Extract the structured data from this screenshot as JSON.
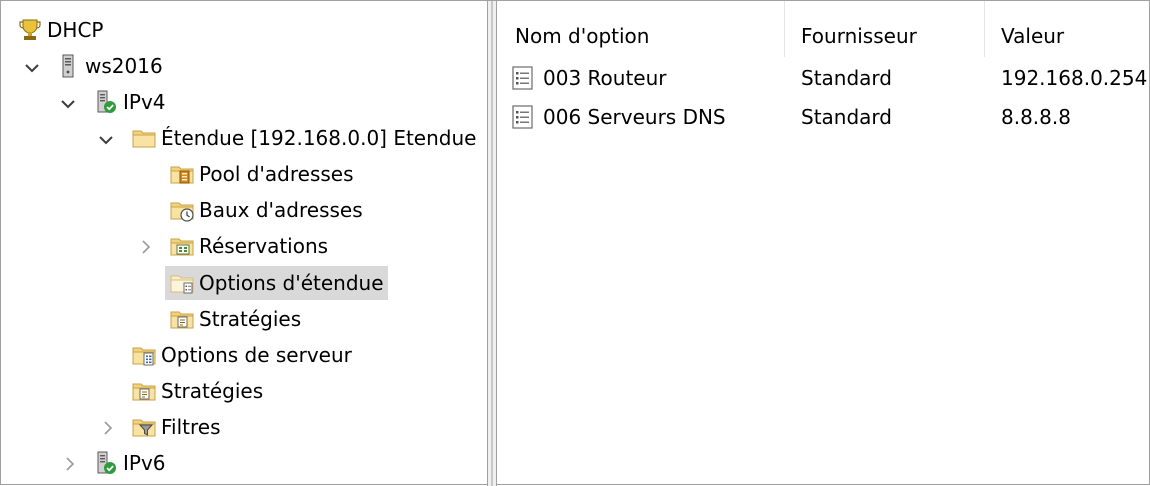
{
  "tree": {
    "nodes": [
      {
        "label": "DHCP",
        "icon": "dhcp-trophy-icon"
      },
      {
        "label": "ws2016",
        "icon": "server-icon"
      },
      {
        "label": "IPv4",
        "icon": "ipv4-icon"
      },
      {
        "label": "Étendue [192.168.0.0] Etendue",
        "icon": "folder-icon"
      },
      {
        "label": "Pool d'adresses",
        "icon": "address-pool-icon"
      },
      {
        "label": "Baux d'adresses",
        "icon": "address-leases-icon"
      },
      {
        "label": "Réservations",
        "icon": "reservations-icon"
      },
      {
        "label": "Options d'étendue",
        "icon": "scope-options-icon",
        "selected": true
      },
      {
        "label": "Stratégies",
        "icon": "policies-icon"
      },
      {
        "label": "Options de serveur",
        "icon": "server-options-icon"
      },
      {
        "label": "Stratégies",
        "icon": "policies-icon"
      },
      {
        "label": "Filtres",
        "icon": "filters-icon"
      },
      {
        "label": "IPv6",
        "icon": "ipv6-icon"
      }
    ]
  },
  "list": {
    "columns": [
      "Nom d'option",
      "Fournisseur",
      "Valeur"
    ],
    "rows": [
      {
        "name": "003 Routeur",
        "vendor": "Standard",
        "value": "192.168.0.254"
      },
      {
        "name": "006 Serveurs DNS",
        "vendor": "Standard",
        "value": "8.8.8.8"
      }
    ]
  },
  "colors": {
    "selection": "#d9d9d9",
    "folder": "#f3d27a",
    "green_check": "#2e9b3c"
  }
}
